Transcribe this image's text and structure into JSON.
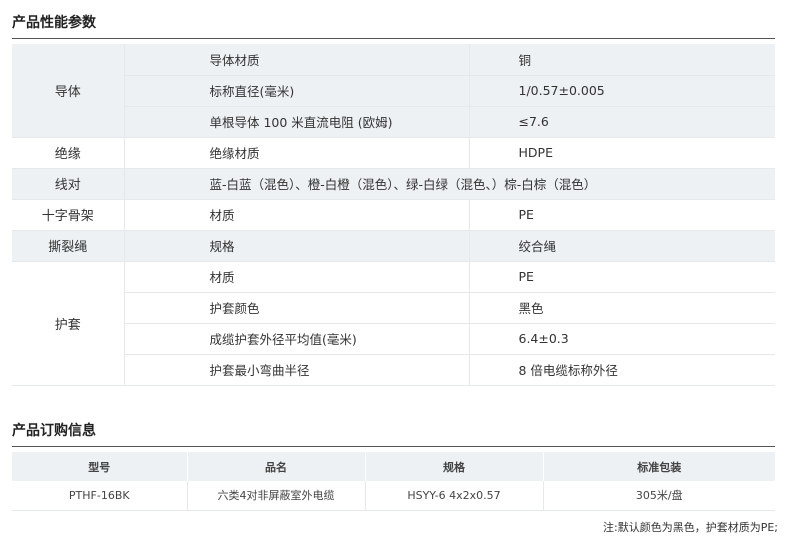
{
  "section1": {
    "title": "产品性能参数"
  },
  "params": {
    "conductor": {
      "label": "导体",
      "rows": [
        {
          "attr": "导体材质",
          "value": "铜"
        },
        {
          "attr": "标称直径(毫米)",
          "value": "1/0.57±0.005"
        },
        {
          "attr": "单根导体 100 米直流电阻 (欧姆)",
          "value": "≤7.6"
        }
      ]
    },
    "insulation": {
      "label": "绝缘",
      "attr": "绝缘材质",
      "value": "HDPE"
    },
    "pairs": {
      "label": "线对",
      "value": "蓝-白蓝（混色）、橙-白橙（混色）、绿-白绿（混色、）棕-白棕（混色）"
    },
    "cross": {
      "label": "十字骨架",
      "attr": "材质",
      "value": "PE"
    },
    "ripcord": {
      "label": "撕裂绳",
      "attr": "规格",
      "value": "绞合绳"
    },
    "jacket": {
      "label": "护套",
      "rows": [
        {
          "attr": "材质",
          "value": "PE"
        },
        {
          "attr": "护套颜色",
          "value": "黑色"
        },
        {
          "attr": "成缆护套外径平均值(毫米)",
          "value": "6.4±0.3"
        },
        {
          "attr": "护套最小弯曲半径",
          "value": "8 倍电缆标称外径"
        }
      ]
    }
  },
  "section2": {
    "title": "产品订购信息"
  },
  "order": {
    "headers": [
      "型号",
      "品名",
      "规格",
      "标准包装"
    ],
    "row": [
      "PTHF-16BK",
      "六类4对非屏蔽室外电缆",
      "HSYY-6 4x2x0.57",
      "305米/盘"
    ]
  },
  "note": "注:默认颜色为黑色，护套材质为PE;"
}
